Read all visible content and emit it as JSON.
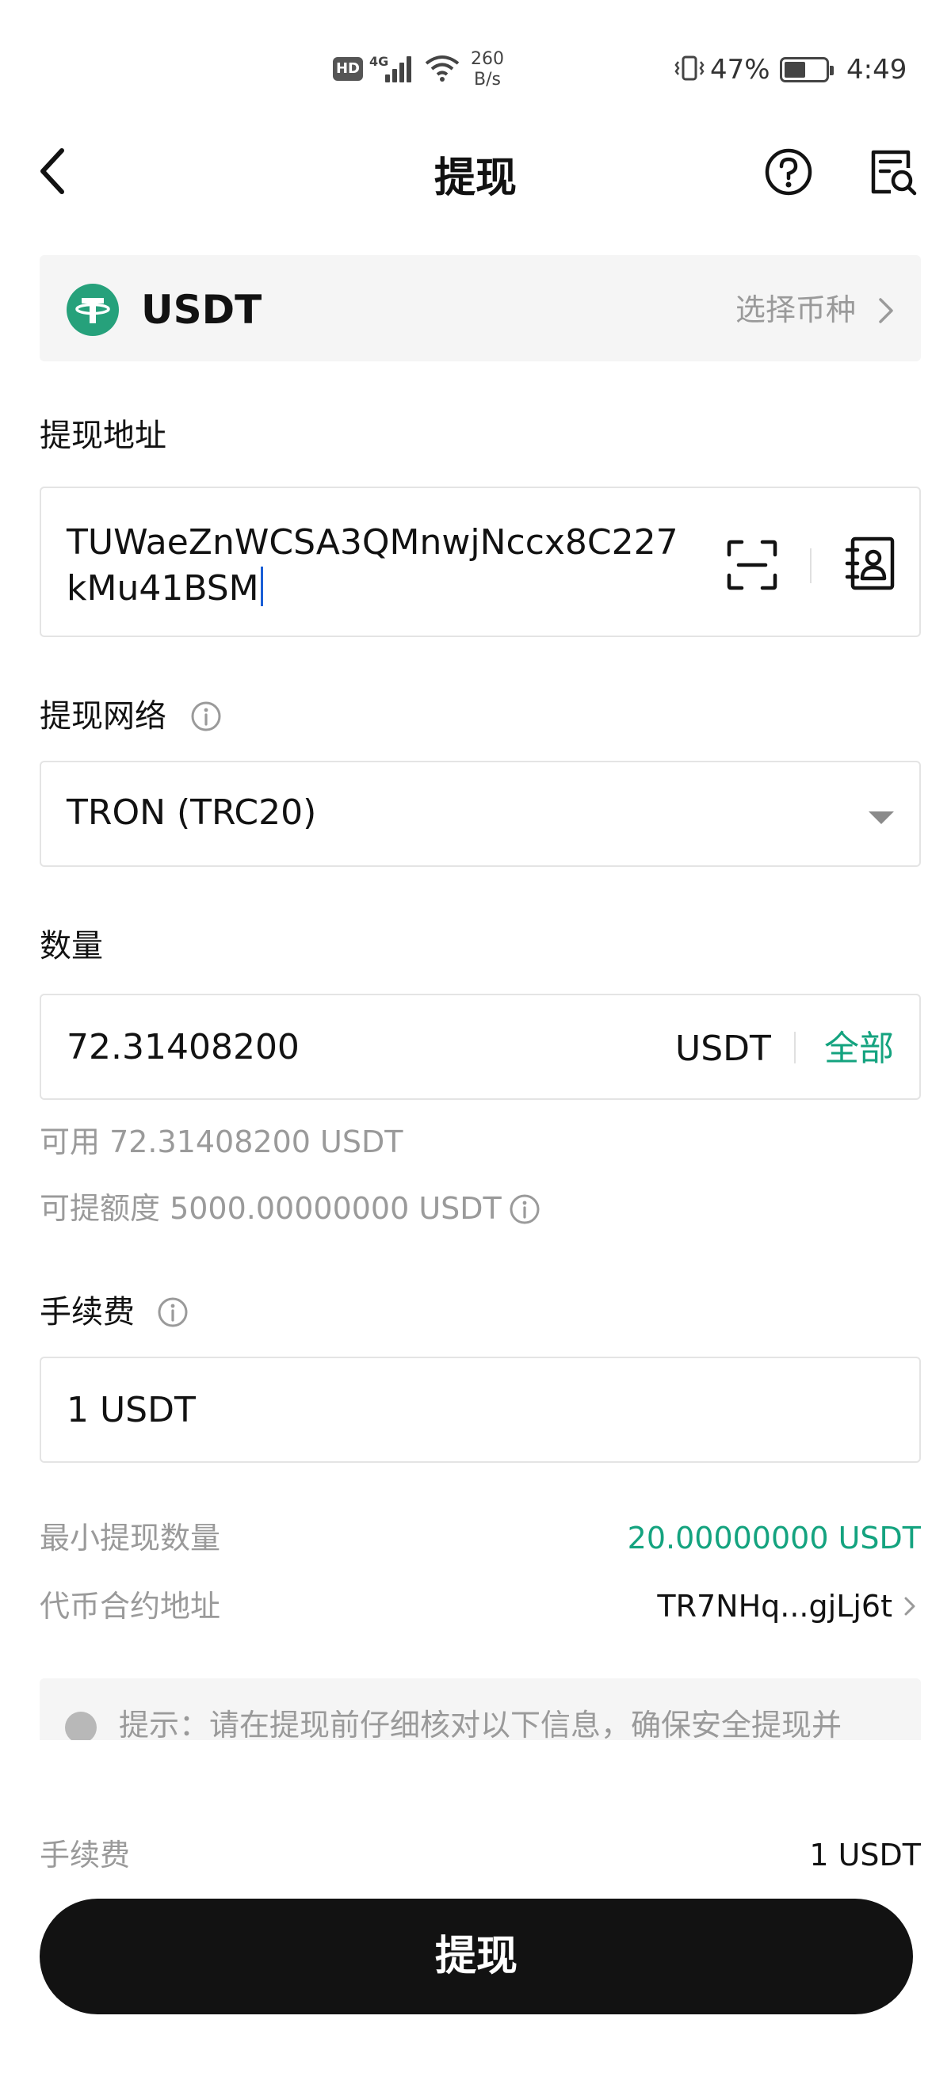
{
  "status_bar": {
    "hd": "HD",
    "network": "4G",
    "speed_value": "260",
    "speed_unit": "B/s",
    "battery": "47%",
    "time": "4:49"
  },
  "header": {
    "title": "提现"
  },
  "coin": {
    "name": "USDT",
    "select_label": "选择币种",
    "logo_color": "#26a17b"
  },
  "address": {
    "label": "提现地址",
    "value": "TUWaeZnWCSA3QMnwjNccx8C227kMu41BSM"
  },
  "network": {
    "label": "提现网络",
    "selected": "TRON (TRC20)"
  },
  "amount": {
    "label": "数量",
    "value": "72.31408200",
    "unit": "USDT",
    "max_label": "全部",
    "available": "可用 72.31408200 USDT",
    "limit": "可提额度 5000.00000000 USDT"
  },
  "fee": {
    "label": "手续费",
    "value": "1 USDT"
  },
  "details": {
    "min_label": "最小提现数量",
    "min_value": "20.00000000 USDT",
    "contract_label": "代币合约地址",
    "contract_value": "TR7NHq...gjLj6t"
  },
  "tip": {
    "text": "提示：请在提现前仔细核对以下信息，确保安全提现并"
  },
  "footer": {
    "fee_label": "手续费",
    "fee_value": "1 USDT",
    "submit_label": "提现"
  },
  "colors": {
    "accent": "#14a37f",
    "primary_button": "#121212",
    "muted_text": "#9a9a9a"
  }
}
